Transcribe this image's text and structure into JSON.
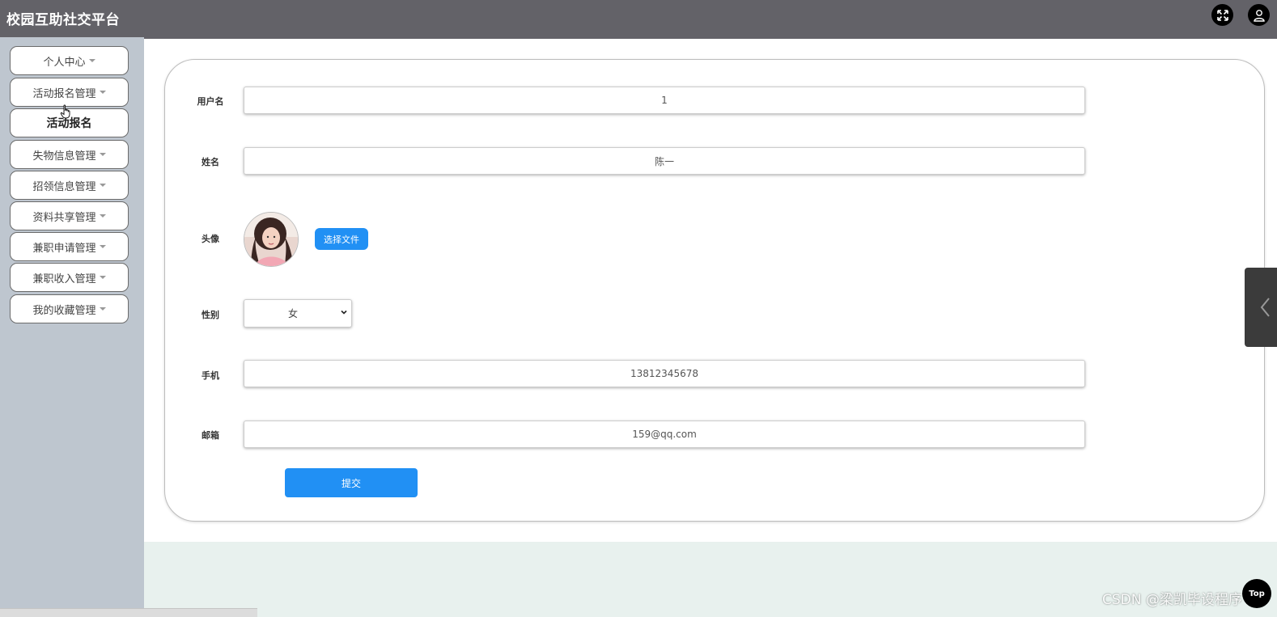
{
  "header": {
    "title": "校园互助社交平台",
    "icons": [
      "fullscreen-icon",
      "user-icon"
    ]
  },
  "sidebar": {
    "items": [
      {
        "label": "个人中心",
        "dropdown": true
      },
      {
        "label": "活动报名管理",
        "dropdown": true
      },
      {
        "label": "活动报名",
        "dropdown": false,
        "active": true
      },
      {
        "label": "失物信息管理",
        "dropdown": true
      },
      {
        "label": "招领信息管理",
        "dropdown": true
      },
      {
        "label": "资料共享管理",
        "dropdown": true
      },
      {
        "label": "兼职申请管理",
        "dropdown": true
      },
      {
        "label": "兼职收入管理",
        "dropdown": true
      },
      {
        "label": "我的收藏管理",
        "dropdown": true
      }
    ]
  },
  "form": {
    "username": {
      "label": "用户名",
      "value": "1"
    },
    "name": {
      "label": "姓名",
      "value": "陈一"
    },
    "avatar": {
      "label": "头像",
      "button": "选择文件"
    },
    "gender": {
      "label": "性别",
      "value": "女"
    },
    "phone": {
      "label": "手机",
      "value": "13812345678"
    },
    "email": {
      "label": "邮箱",
      "value": "159@qq.com"
    },
    "submit": "提交"
  },
  "floating": {
    "top_label": "Top"
  },
  "watermark": "CSDN @梁凯毕设程序",
  "colors": {
    "header_bg": "#636268",
    "sidebar_bg": "#bec6cf",
    "primary": "#2190f4"
  }
}
